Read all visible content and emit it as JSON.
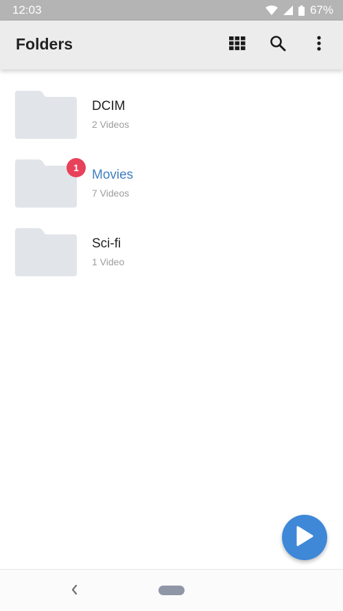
{
  "status_bar": {
    "time": "12:03",
    "battery": "67%",
    "icons": [
      "wifi-icon",
      "signal-icon",
      "battery-icon"
    ]
  },
  "app_bar": {
    "title": "Folders",
    "actions": [
      "grid-view-icon",
      "search-icon",
      "more-vert-icon"
    ]
  },
  "folders": [
    {
      "name": "DCIM",
      "count": "2 Videos",
      "badge": ""
    },
    {
      "name": "Movies",
      "count": "7 Videos",
      "badge": "1"
    },
    {
      "name": "Sci-fi",
      "count": "1 Video",
      "badge": ""
    }
  ],
  "colors": {
    "accent": "#3f88d8",
    "active_text": "#3f7fc1",
    "badge": "#e8415a",
    "folder_fill": "#e1e4e8"
  },
  "fab": {
    "icon": "play-icon"
  },
  "nav_bar": {
    "icons": [
      "back-icon",
      "home-pill-icon"
    ]
  }
}
